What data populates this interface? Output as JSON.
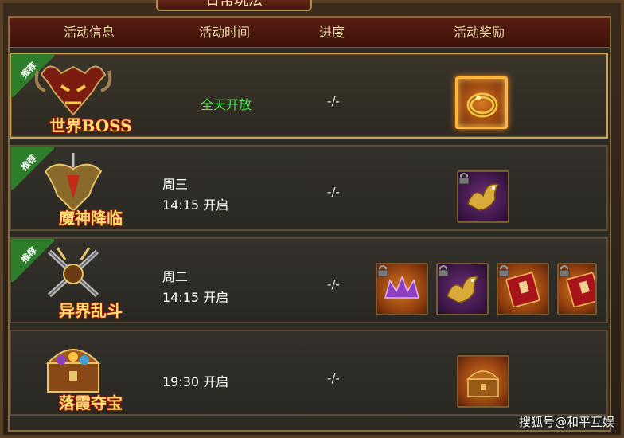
{
  "title": "日常玩法",
  "header": {
    "col_info": "活动信息",
    "col_time": "活动时间",
    "col_progress": "进度",
    "col_reward": "活动奖励"
  },
  "rows": [
    {
      "badge": "推荐",
      "name": "世界BOSS",
      "time_line1": "全天开放",
      "time_line2": "",
      "progress": "-/-",
      "rewards": [
        "ring-icon"
      ]
    },
    {
      "badge": "推荐",
      "name": "魔神降临",
      "time_line1": "周三",
      "time_line2": "14:15 开启",
      "progress": "-/-",
      "rewards": [
        "phoenix-icon"
      ]
    },
    {
      "badge": "推荐",
      "name": "异界乱斗",
      "time_line1": "周二",
      "time_line2": "14:15 开启",
      "progress": "-/-",
      "rewards": [
        "crown-icon",
        "phoenix-icon",
        "red-book-icon",
        "red-book-icon"
      ]
    },
    {
      "badge": "",
      "name": "落霞夺宝",
      "time_line1": "",
      "time_line2": "19:30 开启",
      "progress": "-/-",
      "rewards": [
        "treasure-chest-icon"
      ]
    }
  ],
  "watermark": "搜狐号@和平互娱",
  "colors": {
    "accent_gold": "#ffde73",
    "open_green": "#49e24c",
    "header_red": "#5a1d12",
    "badge_green": "#2e7d2a"
  }
}
